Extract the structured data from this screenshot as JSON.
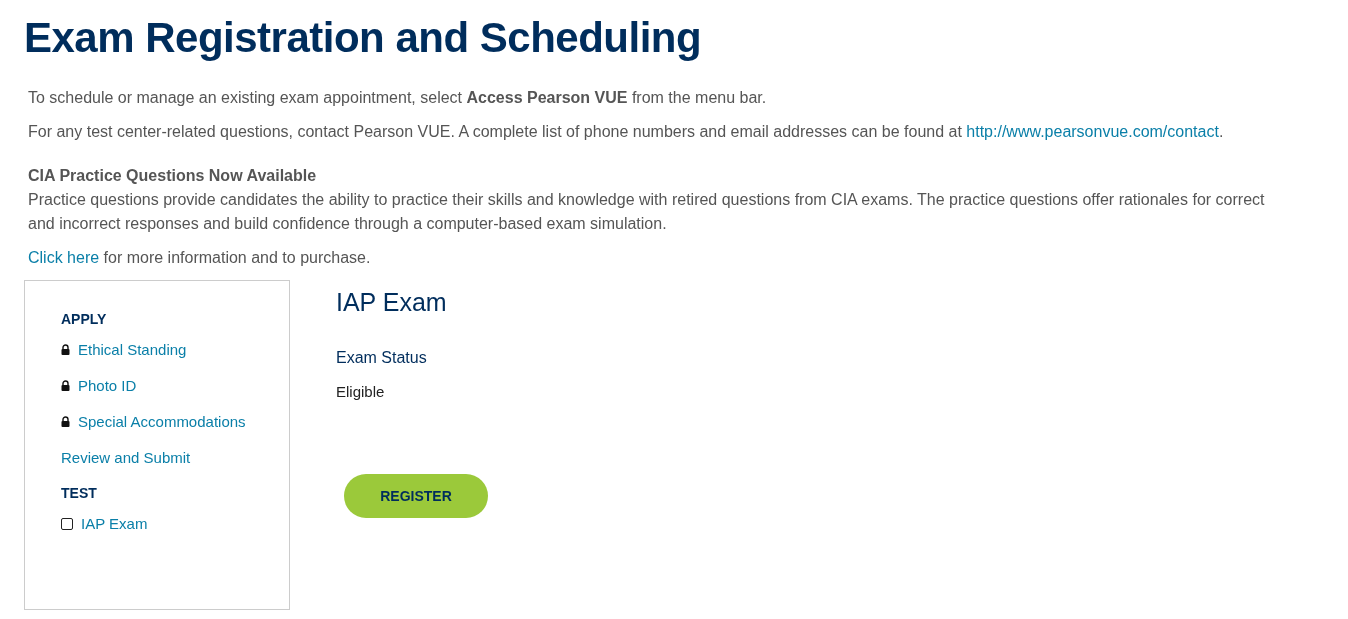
{
  "page_title": "Exam Registration and Scheduling",
  "intro": [
    {
      "kind": "rich",
      "text": "To schedule or manage an existing exam appointment, select **Access Pearson VUE** from the menu bar."
    },
    {
      "kind": "link_after",
      "text": "For any test center-related questions, contact Pearson VUE. A complete list of phone numbers and email addresses can be found at",
      "link": "http://www.pearsonvue.com/contact",
      "tail": "."
    }
  ],
  "practice": {
    "heading": "CIA Practice Questions Now Available",
    "body": "Practice questions provide candidates the ability to practice their skills and knowledge with retired questions from CIA exams. The practice questions offer rationales for correct and incorrect responses and build confidence through a computer-based exam simulation.",
    "link": "Click here",
    "link_tail": " for more information and to purchase."
  },
  "sidebar": {
    "sections": [
      {
        "heading": "APPLY",
        "items": [
          {
            "kind": "locked",
            "label": "Ethical Standing"
          },
          {
            "kind": "locked",
            "label": "Photo ID"
          },
          {
            "kind": "locked",
            "label": "Special Accommodations"
          },
          {
            "kind": "plain",
            "label": "Review and Submit"
          }
        ]
      },
      {
        "heading": "TEST",
        "items": [
          {
            "kind": "checkbox",
            "label": "IAP Exam",
            "checked": false
          }
        ]
      }
    ]
  },
  "exam": {
    "title": "IAP Exam",
    "status_label": "Exam Status",
    "status_value": "Eligible",
    "button": "REGISTER"
  }
}
